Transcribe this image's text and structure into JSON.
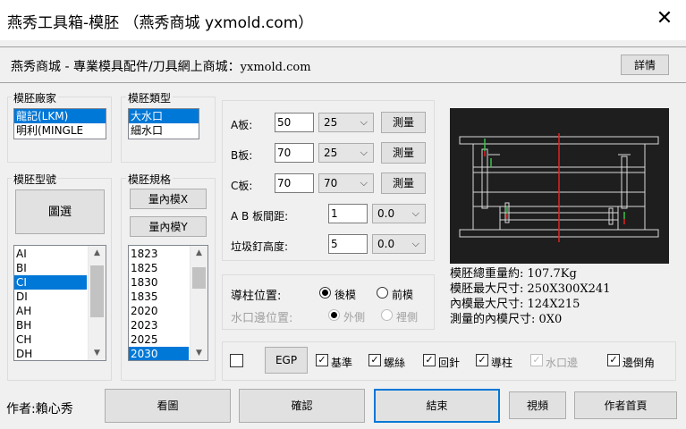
{
  "window": {
    "title": "燕秀工具箱-模胚 （燕秀商城 yxmold.com）",
    "close_symbol": "✕"
  },
  "header": {
    "text": "燕秀商城 - 專業模具配件/刀具網上商城：",
    "url": "yxmold.com",
    "detail_button": "詳情"
  },
  "brand_group": {
    "label": "模胚廠家",
    "items": [
      "龍記(LKM)",
      "明利(MINGLE"
    ],
    "selected": 0
  },
  "type_group": {
    "label": "模胚類型",
    "items": [
      "大水口",
      "細水口"
    ],
    "selected": 0
  },
  "model_group": {
    "label": "模胚型號",
    "select_button": "圖選",
    "items": [
      "AI",
      "BI",
      "CI",
      "DI",
      "AH",
      "BH",
      "CH",
      "DH"
    ],
    "selected": 2
  },
  "spec_group": {
    "label": "模胚規格",
    "measure_x_button": "量內模X",
    "measure_y_button": "量內模Y",
    "items": [
      "1823",
      "1825",
      "1830",
      "1835",
      "2020",
      "2023",
      "2025",
      "2030"
    ],
    "selected": 7
  },
  "plates": {
    "a": {
      "label": "A板:",
      "value": "50",
      "combo": "25",
      "button": "測量"
    },
    "b": {
      "label": "B板:",
      "value": "70",
      "combo": "25",
      "button": "測量"
    },
    "c": {
      "label": "C板:",
      "value": "70",
      "combo": "70",
      "button": "測量"
    },
    "ab_gap": {
      "label": "A B 板間距:",
      "value": "1",
      "combo": "0.0"
    },
    "pin_height": {
      "label": "垃圾釘高度:",
      "value": "5",
      "combo": "0.0"
    }
  },
  "guide": {
    "label": "導柱位置:",
    "opt_back": "後模",
    "opt_front": "前模",
    "selected": "back",
    "gate_label": "水口邊位置:",
    "opt_outer": "外側",
    "opt_inner": "裡側"
  },
  "options": {
    "egp": "EGP",
    "checks": [
      {
        "label": "基準",
        "checked": true,
        "disabled": false
      },
      {
        "label": "螺絲",
        "checked": true,
        "disabled": false
      },
      {
        "label": "回針",
        "checked": true,
        "disabled": false
      },
      {
        "label": "導柱",
        "checked": true,
        "disabled": false
      },
      {
        "label": "水口邊",
        "checked": true,
        "disabled": true
      },
      {
        "label": "邊倒角",
        "checked": true,
        "disabled": false
      }
    ]
  },
  "info": {
    "weight": "模胚總重量約: 107.7Kg",
    "max_size": "模胚最大尺寸: 250X300X241",
    "inner_max": "內模最大尺寸: 124X215",
    "measured": "測量的內模尺寸: 0X0"
  },
  "footer": {
    "author": "作者:賴心秀",
    "view_button": "看圖",
    "confirm_button": "確認",
    "end_button": "結束",
    "video_button": "視頻",
    "homepage_button": "作者首頁"
  },
  "colors": {
    "selection": "#0078d7",
    "preview_bg": "#1e1e1e",
    "accent_red": "#e02020",
    "green": "#3cc04a"
  }
}
